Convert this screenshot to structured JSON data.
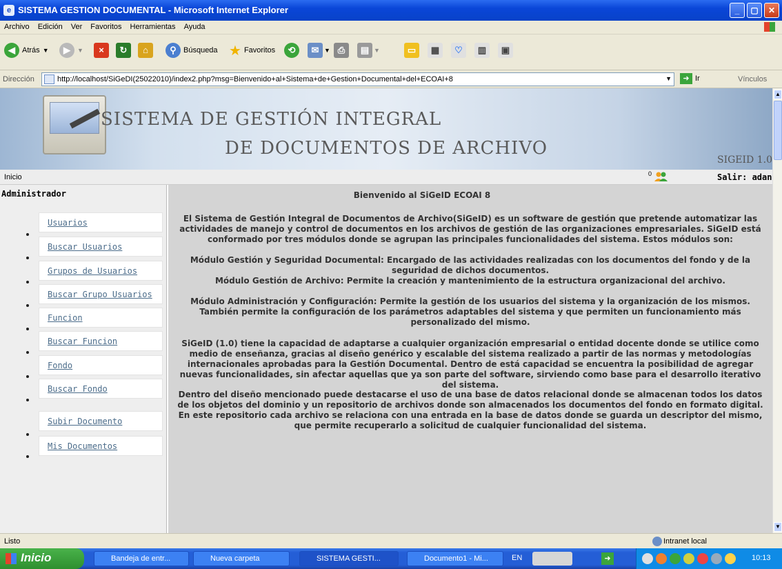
{
  "window": {
    "title": "SISTEMA GESTION DOCUMENTAL - Microsoft Internet Explorer"
  },
  "menu": [
    "Archivo",
    "Edición",
    "Ver",
    "Favoritos",
    "Herramientas",
    "Ayuda"
  ],
  "toolbar": {
    "back": "Atrás",
    "search": "Búsqueda",
    "favorites": "Favoritos"
  },
  "address": {
    "label": "Dirección",
    "url": "http://localhost/SiGeDI(25022010)/index2.php?msg=Bienvenido+al+Sistema+de+Gestion+Documental+del+ECOAI+8",
    "go": "Ir",
    "links": "Vínculos"
  },
  "banner": {
    "line1": "SISTEMA DE GESTIÓN INTEGRAL",
    "line2": "DE DOCUMENTOS DE ARCHIVO",
    "version": "SIGEID 1.0"
  },
  "nav": {
    "home": "Inicio",
    "online_count": "0",
    "logout": "Salir: adan"
  },
  "sidebar": {
    "title": "Administrador",
    "items": [
      {
        "label": "Usuarios"
      },
      {
        "label": "Buscar Usuarios"
      },
      {
        "label": "Grupos de Usuarios"
      },
      {
        "label": "Buscar Grupo Usuarios"
      },
      {
        "label": "Funcion"
      },
      {
        "label": "Buscar Funcion"
      },
      {
        "label": "Fondo"
      },
      {
        "label": "Buscar Fondo"
      },
      {
        "label": "Subir Documento"
      },
      {
        "label": "Mis Documentos"
      }
    ]
  },
  "main": {
    "welcome": "Bienvenido al SiGeID ECOAI 8",
    "para1": "El Sistema de Gestión Integral de Documentos de Archivo(SiGeID) es un software de gestión que pretende automatizar las actividades de manejo y control de documentos en los archivos de gestión de las organizaciones empresariales. SiGeID está conformado por tres módulos donde se agrupan las principales funcionalidades del sistema. Estos módulos son:",
    "modules": [
      "Módulo Gestión y Seguridad Documental: Encargado de las actividades realizadas con los documentos del fondo y de la seguridad de dichos documentos.",
      "Módulo Gestión de Archivo: Permite la creación y mantenimiento de la estructura organizacional del archivo.",
      "Módulo Administración y Configuración: Permite la gestión de los usuarios del sistema y la organización de los mismos. También permite la configuración de los parámetros adaptables del sistema y que permiten un funcionamiento más personalizado del mismo."
    ],
    "para2": "SiGeID (1.0) tiene la capacidad de adaptarse a cualquier organización empresarial o entidad docente donde se utilice como medio de enseñanza, gracias al diseño genérico y escalable del sistema realizado a partir de las normas y metodologías internacionales aprobadas para la Gestión Documental. Dentro de está capacidad se encuentra la posibilidad de agregar nuevas funcionalidades, sin afectar aquellas que ya son parte del software, sirviendo como base para el desarrollo iterativo del sistema.",
    "para3": "Dentro del diseño mencionado puede destacarse el uso de una base de datos relacional donde se almacenan todos los datos de los objetos del dominio y un repositorio de archivos donde son almacenados los documentos del fondo en formato digital. En este repositorio cada archivo se relaciona con una entrada en la base de datos donde se guarda un descriptor del mismo, que permite recuperarlo a solicitud de cualquier funcionalidad del sistema."
  },
  "status": {
    "text": "Listo",
    "zone": "Intranet local"
  },
  "taskbar": {
    "start": "Inicio",
    "tasks": [
      "Bandeja de entr...",
      "Nueva carpeta",
      "SISTEMA GESTI...",
      "Documento1 - Mi..."
    ],
    "lang": "EN",
    "clock": "10:13"
  },
  "colors": {
    "titlebar": "#0a46d8",
    "main_bg": "#d4d4d4",
    "link": "#4b6c8a",
    "taskbar": "#245ed6",
    "start": "#2e8f2f"
  }
}
